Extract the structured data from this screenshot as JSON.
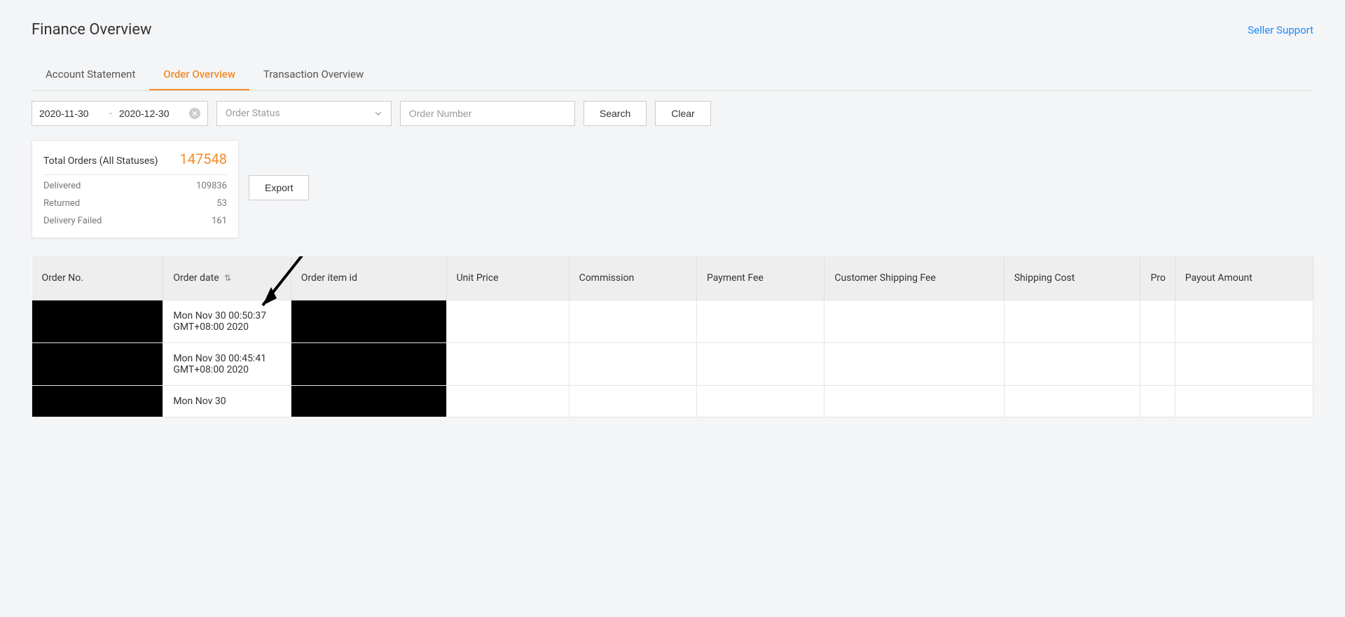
{
  "header": {
    "title": "Finance Overview",
    "support_link": "Seller Support"
  },
  "tabs": {
    "items": [
      {
        "label": "Account Statement",
        "active": false
      },
      {
        "label": "Order Overview",
        "active": true
      },
      {
        "label": "Transaction Overview",
        "active": false
      }
    ]
  },
  "filters": {
    "date_from": "2020-11-30",
    "date_to": "2020-12-30",
    "status_placeholder": "Order Status",
    "order_number_placeholder": "Order Number",
    "search_label": "Search",
    "clear_label": "Clear"
  },
  "summary": {
    "total_label": "Total Orders (All Statuses)",
    "total_value": "147548",
    "lines": [
      {
        "label": "Delivered",
        "value": "109836"
      },
      {
        "label": "Returned",
        "value": "53"
      },
      {
        "label": "Delivery Failed",
        "value": "161"
      }
    ]
  },
  "export_label": "Export",
  "table": {
    "columns": [
      "Order No.",
      "Order date",
      "Order item id",
      "Unit Price",
      "Commission",
      "Payment Fee",
      "Customer Shipping Fee",
      "Shipping Cost",
      "Pro",
      "Payout Amount"
    ],
    "rows": [
      {
        "order_no": "",
        "order_date": "Mon Nov 30 00:50:37 GMT+08:00 2020",
        "order_item_id": "",
        "unit_price": "",
        "commission": "",
        "payment_fee": "",
        "customer_shipping_fee": "",
        "shipping_cost": "",
        "pro": "",
        "payout_amount": ""
      },
      {
        "order_no": "",
        "order_date": "Mon Nov 30 00:45:41 GMT+08:00 2020",
        "order_item_id": "",
        "unit_price": "",
        "commission": "",
        "payment_fee": "",
        "customer_shipping_fee": "",
        "shipping_cost": "",
        "pro": "",
        "payout_amount": ""
      },
      {
        "order_no": "",
        "order_date": "Mon Nov 30",
        "order_item_id": "",
        "unit_price": "",
        "commission": "",
        "payment_fee": "",
        "customer_shipping_fee": "",
        "shipping_cost": "",
        "pro": "",
        "payout_amount": ""
      }
    ]
  }
}
